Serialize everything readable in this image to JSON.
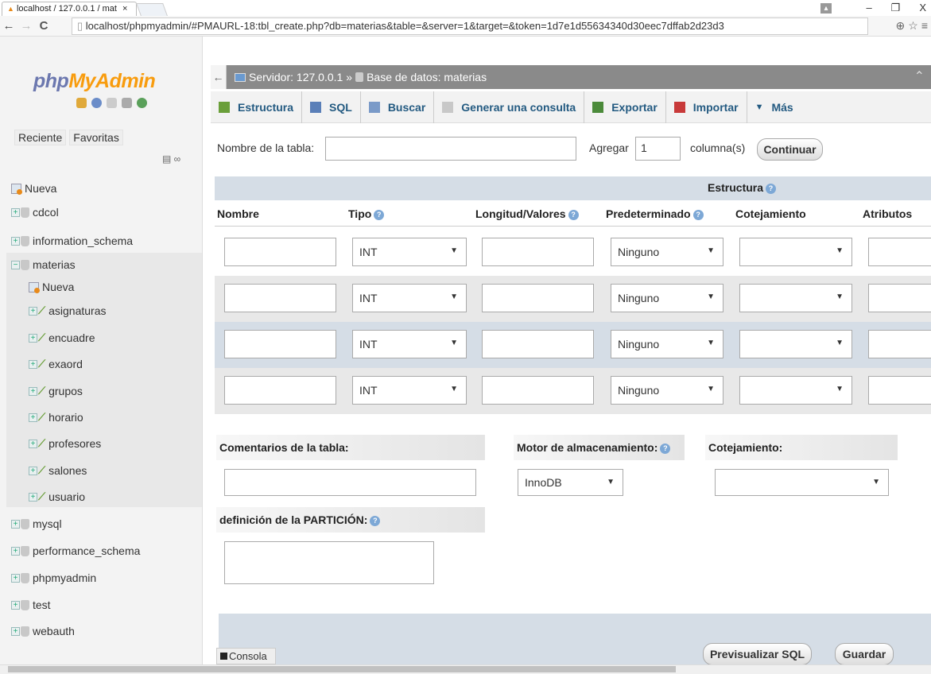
{
  "browser": {
    "tab_title": "localhost / 127.0.0.1 / mat",
    "tab_close": "×",
    "url": "localhost/phpmyadmin/#PMAURL-18:tbl_create.php?db=materias&table=&server=1&target=&token=1d7e1d55634340d30eec7dffab2d23d3",
    "url_scheme_host": "localhost",
    "back": "←",
    "forward": "→",
    "reload": "C",
    "window_controls": [
      "–",
      "❐",
      "X"
    ],
    "zoom_icon": "zoom-icon",
    "star_icon": "star-icon",
    "menu_icon": "menu-icon"
  },
  "sidebar": {
    "logo_php": "php",
    "logo_myadmin": "MyAdmin",
    "tabs": [
      "Reciente",
      "Favoritas"
    ],
    "items": [
      {
        "label": "Nueva",
        "kind": "new",
        "indent": 0
      },
      {
        "label": "cdcol",
        "kind": "db",
        "indent": 0
      },
      {
        "label": "information_schema",
        "kind": "db",
        "indent": 0
      },
      {
        "label": "materias",
        "kind": "db-open",
        "indent": 0
      },
      {
        "label": "Nueva",
        "kind": "new",
        "indent": 1
      },
      {
        "label": "asignaturas",
        "kind": "table",
        "indent": 1
      },
      {
        "label": "encuadre",
        "kind": "table",
        "indent": 1
      },
      {
        "label": "exaord",
        "kind": "table",
        "indent": 1
      },
      {
        "label": "grupos",
        "kind": "table",
        "indent": 1
      },
      {
        "label": "horario",
        "kind": "table",
        "indent": 1
      },
      {
        "label": "profesores",
        "kind": "table",
        "indent": 1
      },
      {
        "label": "salones",
        "kind": "table",
        "indent": 1
      },
      {
        "label": "usuario",
        "kind": "table",
        "indent": 1
      },
      {
        "label": "mysql",
        "kind": "db",
        "indent": 0
      },
      {
        "label": "performance_schema",
        "kind": "db",
        "indent": 0
      },
      {
        "label": "phpmyadmin",
        "kind": "db",
        "indent": 0
      },
      {
        "label": "test",
        "kind": "db",
        "indent": 0
      },
      {
        "label": "webauth",
        "kind": "db",
        "indent": 0
      }
    ]
  },
  "breadcrumb": {
    "server": "Servidor: 127.0.0.1",
    "sep": "»",
    "database": "Base de datos: materias",
    "back": "←"
  },
  "menu": [
    {
      "label": "Estructura",
      "icon": "structure-icon",
      "color": "#6a9f3a"
    },
    {
      "label": "SQL",
      "icon": "sql-icon",
      "color": "#5a7fb8"
    },
    {
      "label": "Buscar",
      "icon": "search-icon",
      "color": "#7a9ac8"
    },
    {
      "label": "Generar una consulta",
      "icon": "query-icon",
      "color": "#c8c8c8"
    },
    {
      "label": "Exportar",
      "icon": "export-icon",
      "color": "#4b8a3a"
    },
    {
      "label": "Importar",
      "icon": "import-icon",
      "color": "#c83a3a"
    },
    {
      "label": "Más",
      "icon": "chevron-down-icon",
      "color": "#235a81"
    }
  ],
  "create": {
    "table_name_label": "Nombre de la tabla:",
    "table_name_value": "",
    "add_label": "Agregar",
    "add_value": "1",
    "columns_label": "columna(s)",
    "continue_label": "Continuar"
  },
  "structure": {
    "title": "Estructura",
    "headers": {
      "name": "Nombre",
      "type": "Tipo",
      "length": "Longitud/Valores",
      "default": "Predeterminado",
      "collation": "Cotejamiento",
      "attributes": "Atributos"
    },
    "rows": [
      {
        "name": "",
        "type": "INT",
        "length": "",
        "default": "Ninguno",
        "collation": ""
      },
      {
        "name": "",
        "type": "INT",
        "length": "",
        "default": "Ninguno",
        "collation": ""
      },
      {
        "name": "",
        "type": "INT",
        "length": "",
        "default": "Ninguno",
        "collation": ""
      },
      {
        "name": "",
        "type": "INT",
        "length": "",
        "default": "Ninguno",
        "collation": ""
      }
    ]
  },
  "table_options": {
    "comments_label": "Comentarios de la tabla:",
    "engine_label": "Motor de almacenamiento:",
    "engine_value": "InnoDB",
    "collation_label": "Cotejamiento:",
    "collation_value": "",
    "partition_label": "definición de la PARTICIÓN:"
  },
  "footer": {
    "console": "Consola",
    "preview_sql": "Previsualizar SQL",
    "save": "Guardar"
  },
  "colors": {
    "accent_blue": "#235a81",
    "breadcrumb_bg": "#8a8a8a",
    "header_bg": "#d5dde6",
    "logo_blue": "#6c78af",
    "logo_orange": "#f89c0e"
  }
}
